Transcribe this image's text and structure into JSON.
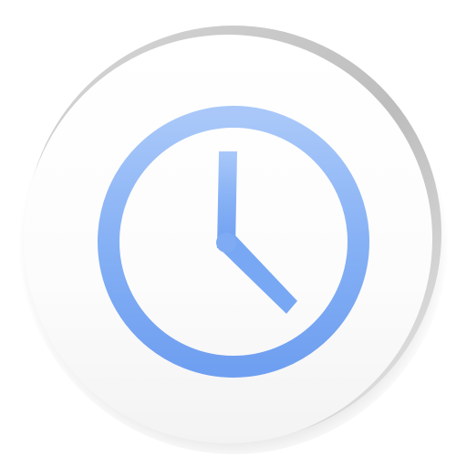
{
  "app_icon": {
    "icon_name": "clock-icon",
    "colors": {
      "background": "#ffffff",
      "button_face": "#fbfbfb",
      "button_shadow": "#c9c9c9",
      "clock_blue_light": "#a6c6f8",
      "clock_blue": "#7aaaf4",
      "clock_blue_dark": "#6c9ff0"
    }
  }
}
